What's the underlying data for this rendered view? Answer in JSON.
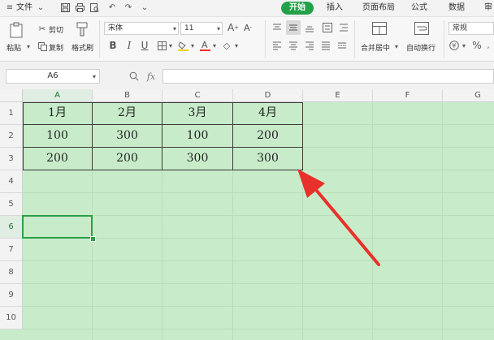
{
  "menubar": {
    "file_label": "文件",
    "tabs": [
      "开始",
      "插入",
      "页面布局",
      "公式",
      "数据",
      "审"
    ]
  },
  "ribbon": {
    "paste": "粘贴",
    "cut": "剪切",
    "copy": "复制",
    "format_painter": "格式刷",
    "font_name": "宋体",
    "font_size": "11",
    "bold": "B",
    "italic": "I",
    "underline": "U",
    "merge_center": "合并居中",
    "wrap_text": "自动换行",
    "number_format": "常规",
    "percent": "%"
  },
  "formula_bar": {
    "cell_ref": "A6",
    "fx": "fx",
    "value": ""
  },
  "sheet": {
    "columns": [
      "A",
      "B",
      "C",
      "D",
      "E",
      "F",
      "G"
    ],
    "rows": [
      "1",
      "2",
      "3",
      "4",
      "5",
      "6",
      "7",
      "8",
      "9",
      "10"
    ],
    "table": [
      [
        "1月",
        "2月",
        "3月",
        "4月"
      ],
      [
        "100",
        "300",
        "100",
        "200"
      ],
      [
        "200",
        "200",
        "300",
        "300"
      ]
    ],
    "selected_cell": "A6"
  },
  "colors": {
    "accent": "#22a149",
    "sheet_background": "#c8ecca",
    "arrow": "#e8312a"
  },
  "icons": [
    "save-icon",
    "print-icon",
    "print-preview-icon",
    "undo-icon",
    "redo-icon",
    "dropdown-icon",
    "search-icon",
    "arrow-annotation"
  ]
}
